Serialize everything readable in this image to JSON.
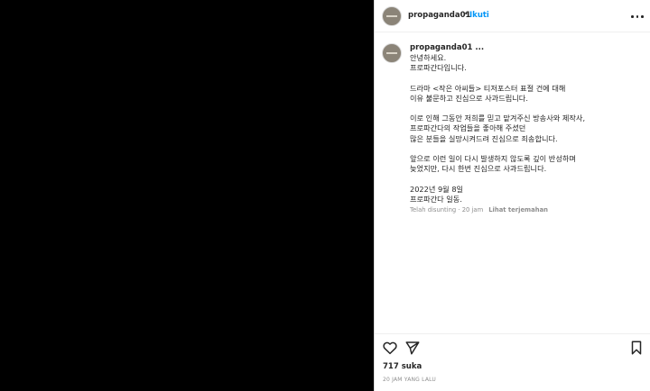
{
  "post": {
    "username": "propaganda01",
    "separator": "•",
    "follow_label": "Ikuti",
    "caption_username": "propaganda01 ...",
    "caption_text": "안녕하세요.\n프로파간다입니다.\n\n드라마 <작은 아씨들> 티저포스터 표절 건에 대해\n이유 불문하고 진심으로 사과드립니다.\n\n이로 인해 그동안 저희를 믿고 맡겨주신 방송사와 제작사,\n프로파간다의 작업들을 좋아해 주셨던\n많은 분들을 실망시켜드려 진심으로 죄송합니다.\n\n앞으로 이런 일이 다시 발생하지 않도록 깊이 반성하며\n늦었지만, 다시 한번 진심으로 사과드립니다.\n\n2022년 9월 8일\n프로파간다 일동.",
    "edited_meta": "Telah disunting · 20 jam",
    "translate_label": "Lihat terjemahan",
    "likes": "717 suka",
    "timestamp": "20 JAM YANG LALU"
  },
  "icons": {
    "more": "more-options-icon",
    "like": "heart-icon",
    "share": "send-icon",
    "save": "bookmark-icon"
  },
  "colors": {
    "media_background": "#000000",
    "follow": "#0095f6",
    "text": "#262626",
    "muted": "#8e8e8e",
    "avatar": "#8b8478"
  }
}
